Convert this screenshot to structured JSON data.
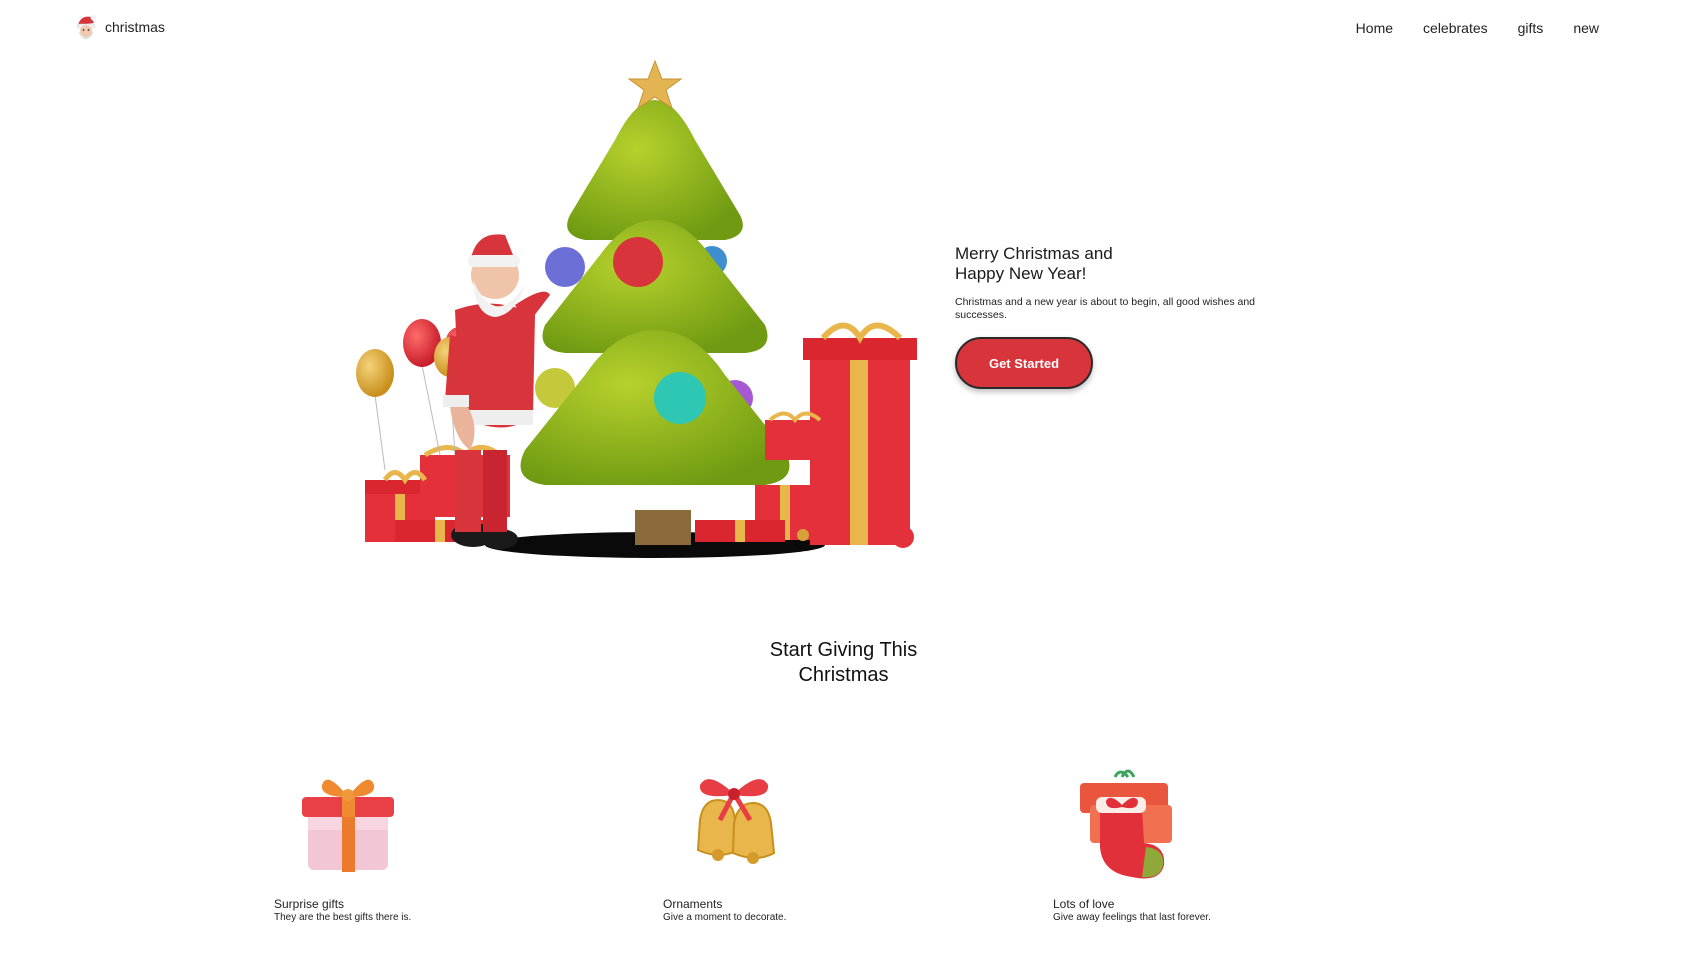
{
  "brand": {
    "name": "christmas",
    "logo_icon": "santa-head-icon"
  },
  "nav": {
    "items": [
      {
        "label": "Home"
      },
      {
        "label": "celebrates"
      },
      {
        "label": "gifts"
      },
      {
        "label": "new"
      }
    ]
  },
  "hero": {
    "title_line1": "Merry Christmas and",
    "title_line2": "Happy New Year!",
    "subtitle": "Christmas and a new year is about to begin, all good wishes and successes.",
    "cta_label": "Get Started",
    "illustration_icon": "santa-christmas-tree-illustration"
  },
  "section": {
    "title_line1": "Start Giving This",
    "title_line2": "Christmas"
  },
  "features": [
    {
      "title": "Surprise gifts",
      "description": "They are the best gifts there is.",
      "icon": "gift-box-icon"
    },
    {
      "title": "Ornaments",
      "description": "Give a moment to decorate.",
      "icon": "bells-icon"
    },
    {
      "title": "Lots of love",
      "description": "Give away feelings that last forever.",
      "icon": "stocking-icon"
    }
  ],
  "colors": {
    "accent": "#d8343b",
    "tree_green": "#8fb51e",
    "gift_red": "#e3303a",
    "ribbon_gold": "#e8b64a"
  }
}
